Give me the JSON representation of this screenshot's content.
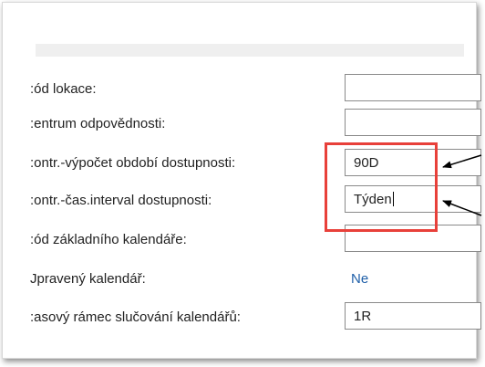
{
  "fields": [
    {
      "label": ":ód lokace:",
      "value": ""
    },
    {
      "label": ":entrum odpovědnosti:",
      "value": ""
    },
    {
      "label": ":ontr.-výpočet období dostupnosti:",
      "value": "90D"
    },
    {
      "label": ":ontr.-čas.interval dostupnosti:",
      "value": "Týden"
    },
    {
      "label": ":ód základního kalendáře:",
      "value": ""
    },
    {
      "label": "Jpravený kalendář:",
      "value": "Ne"
    },
    {
      "label": ":asový rámec slučování kalendářů:",
      "value": "1R"
    }
  ],
  "colors": {
    "highlight": "#e8403a",
    "link": "#1f5fa8",
    "band": "#efefef"
  }
}
